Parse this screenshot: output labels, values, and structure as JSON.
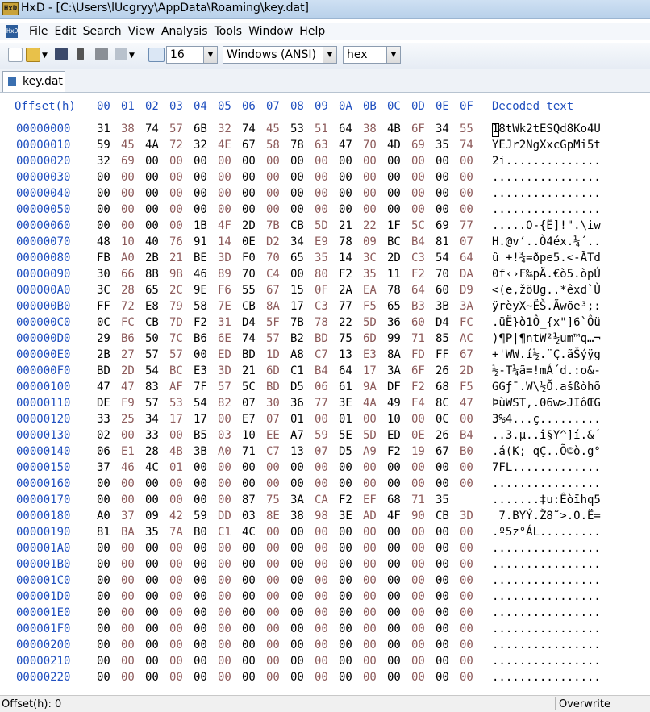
{
  "window": {
    "title": "HxD - [C:\\Users\\lUcgryy\\AppData\\Roaming\\key.dat]"
  },
  "menu": [
    "File",
    "Edit",
    "Search",
    "View",
    "Analysis",
    "Tools",
    "Window",
    "Help"
  ],
  "toolbar": {
    "bytes_per_row": "16",
    "charset": "Windows (ANSI)",
    "display_mode": "hex"
  },
  "tab": {
    "label": "key.dat"
  },
  "hex": {
    "header_offset": "Offset(h)",
    "header_columns": [
      "00",
      "01",
      "02",
      "03",
      "04",
      "05",
      "06",
      "07",
      "08",
      "09",
      "0A",
      "0B",
      "0C",
      "0D",
      "0E",
      "0F"
    ],
    "header_decoded": "Decoded text",
    "rows": [
      {
        "offset": "00000000",
        "bytes": "31 38 74 57 6B 32 74 45 53 51 64 38 4B 6F 34 55",
        "text": "18tWk2tESQd8Ko4U"
      },
      {
        "offset": "00000010",
        "bytes": "59 45 4A 72 32 4E 67 58 78 63 47 70 4D 69 35 74",
        "text": "YEJr2NgXxcGpMi5t"
      },
      {
        "offset": "00000020",
        "bytes": "32 69 00 00 00 00 00 00 00 00 00 00 00 00 00 00",
        "text": "2i.............."
      },
      {
        "offset": "00000030",
        "bytes": "00 00 00 00 00 00 00 00 00 00 00 00 00 00 00 00",
        "text": "................"
      },
      {
        "offset": "00000040",
        "bytes": "00 00 00 00 00 00 00 00 00 00 00 00 00 00 00 00",
        "text": "................"
      },
      {
        "offset": "00000050",
        "bytes": "00 00 00 00 00 00 00 00 00 00 00 00 00 00 00 00",
        "text": "................"
      },
      {
        "offset": "00000060",
        "bytes": "00 00 00 00 1B 4F 2D 7B CB 5D 21 22 1F 5C 69 77",
        "text": ".....O-{Ë]!\".\\iw"
      },
      {
        "offset": "00000070",
        "bytes": "48 10 40 76 91 14 0E D2 34 E9 78 09 BC B4 81 07",
        "text": "H.@v‘..Ò4éx.¼´.."
      },
      {
        "offset": "00000080",
        "bytes": "FB A0 2B 21 BE 3D F0 70 65 35 14 3C 2D C3 54 64",
        "text": "û +!¾=ðpe5.<-ÃTd"
      },
      {
        "offset": "00000090",
        "bytes": "30 66 8B 9B 46 89 70 C4 00 80 F2 35 11 F2 70 DA",
        "text": "0f‹›F‰pÄ.€ò5.òpÚ"
      },
      {
        "offset": "000000A0",
        "bytes": "3C 28 65 2C 9E F6 55 67 15 0F 2A EA 78 64 60 D9",
        "text": "<(e,žöUg..*êxd`Ù"
      },
      {
        "offset": "000000B0",
        "bytes": "FF 72 E8 79 58 7E CB 8A 17 C3 77 F5 65 B3 3B 3A",
        "text": "ÿrèyX~ËŠ.Ãwõe³;:"
      },
      {
        "offset": "000000C0",
        "bytes": "0C FC CB 7D F2 31 D4 5F 7B 78 22 5D 36 60 D4 FC",
        "text": ".üË}ò1Ô_{x\"]6`Ôü"
      },
      {
        "offset": "000000D0",
        "bytes": "29 B6 50 7C B6 6E 74 57 B2 BD 75 6D 99 71 85 AC",
        "text": ")¶P|¶ntW²½um™q…¬"
      },
      {
        "offset": "000000E0",
        "bytes": "2B 27 57 57 00 ED BD 1D A8 C7 13 E3 8A FD FF 67",
        "text": "+'WW.í½.¨Ç.ãŠýÿg"
      },
      {
        "offset": "000000F0",
        "bytes": "BD 2D 54 BC E3 3D 21 6D C1 B4 64 17 3A 6F 26 2D",
        "text": "½-T¼ã=!mÁ´d.:o&-"
      },
      {
        "offset": "00000100",
        "bytes": "47 47 83 AF 7F 57 5C BD D5 06 61 9A DF F2 68 F5",
        "text": "GGƒ¯.W\\½Õ.ašßòhõ"
      },
      {
        "offset": "00000110",
        "bytes": "DE F9 57 53 54 82 07 30 36 77 3E 4A 49 F4 8C 47",
        "text": "ÞùWST‚.06w>JIôŒG"
      },
      {
        "offset": "00000120",
        "bytes": "33 25 34 17 17 00 E7 07 01 00 01 00 10 00 0C 00",
        "text": "3%4...ç........."
      },
      {
        "offset": "00000130",
        "bytes": "02 00 33 00 B5 03 10 EE A7 59 5E 5D ED 0E 26 B4",
        "text": "..3.µ..î§Y^]í.&´"
      },
      {
        "offset": "00000140",
        "bytes": "06 E1 28 4B 3B A0 71 C7 13 07 D5 A9 F2 19 67 B0",
        "text": ".á(K; qÇ..Õ©ò.g°"
      },
      {
        "offset": "00000150",
        "bytes": "37 46 4C 01 00 00 00 00 00 00 00 00 00 00 00 00",
        "text": "7FL............."
      },
      {
        "offset": "00000160",
        "bytes": "00 00 00 00 00 00 00 00 00 00 00 00 00 00 00 00",
        "text": "................"
      },
      {
        "offset": "00000170",
        "bytes": "00 00 00 00 00 00 87 75 3A CA F2 EF 68 71 35",
        "text": ".......‡u:Êòïhq5"
      },
      {
        "offset": "00000180",
        "bytes": "A0 37 09 42 59 DD 03 8E 38 98 3E AD 4F 90 CB 3D",
        "text": " 7.BYÝ.Ž8˜>.O.Ë="
      },
      {
        "offset": "00000190",
        "bytes": "81 BA 35 7A B0 C1 4C 00 00 00 00 00 00 00 00 00",
        "text": ".º5z°ÁL........."
      },
      {
        "offset": "000001A0",
        "bytes": "00 00 00 00 00 00 00 00 00 00 00 00 00 00 00 00",
        "text": "................"
      },
      {
        "offset": "000001B0",
        "bytes": "00 00 00 00 00 00 00 00 00 00 00 00 00 00 00 00",
        "text": "................"
      },
      {
        "offset": "000001C0",
        "bytes": "00 00 00 00 00 00 00 00 00 00 00 00 00 00 00 00",
        "text": "................"
      },
      {
        "offset": "000001D0",
        "bytes": "00 00 00 00 00 00 00 00 00 00 00 00 00 00 00 00",
        "text": "................"
      },
      {
        "offset": "000001E0",
        "bytes": "00 00 00 00 00 00 00 00 00 00 00 00 00 00 00 00",
        "text": "................"
      },
      {
        "offset": "000001F0",
        "bytes": "00 00 00 00 00 00 00 00 00 00 00 00 00 00 00 00",
        "text": "................"
      },
      {
        "offset": "00000200",
        "bytes": "00 00 00 00 00 00 00 00 00 00 00 00 00 00 00 00",
        "text": "................"
      },
      {
        "offset": "00000210",
        "bytes": "00 00 00 00 00 00 00 00 00 00 00 00 00 00 00 00",
        "text": "................"
      },
      {
        "offset": "00000220",
        "bytes": "00 00 00 00 00 00 00 00 00 00 00 00 00 00 00 00",
        "text": "................"
      }
    ]
  },
  "status": {
    "offset": "Offset(h): 0",
    "mode": "Overwrite"
  }
}
